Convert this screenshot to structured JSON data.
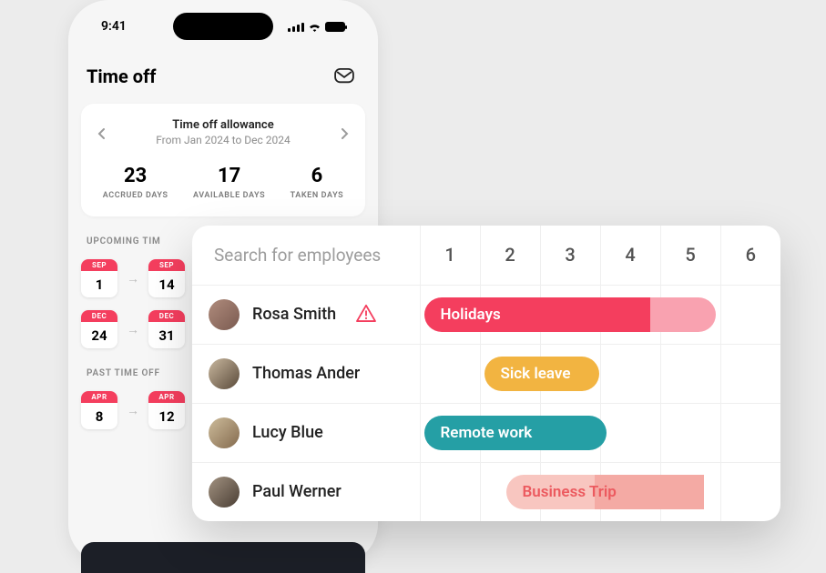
{
  "statusbar": {
    "time": "9:41"
  },
  "header": {
    "title": "Time off",
    "mail_icon": "mail-icon"
  },
  "allowance": {
    "title": "Time off allowance",
    "subtitle": "From Jan 2024 to Dec 2024",
    "stats": [
      {
        "value": "23",
        "label": "ACCRUED DAYS"
      },
      {
        "value": "17",
        "label": "AVAILABLE DAYS"
      },
      {
        "value": "6",
        "label": "TAKEN DAYS"
      }
    ]
  },
  "sections": {
    "upcoming": {
      "heading": "UPCOMING TIM",
      "rows": [
        {
          "from": {
            "month": "SEP",
            "day": "1"
          },
          "to": {
            "month": "SEP",
            "day": "14"
          }
        },
        {
          "from": {
            "month": "DEC",
            "day": "24"
          },
          "to": {
            "month": "DEC",
            "day": "31"
          }
        }
      ]
    },
    "past": {
      "heading": "PAST TIME OFF",
      "rows": [
        {
          "from": {
            "month": "APR",
            "day": "8"
          },
          "to": {
            "month": "APR",
            "day": "12"
          }
        }
      ]
    }
  },
  "panel": {
    "search_placeholder": "Search for employees",
    "columns": [
      "1",
      "2",
      "3",
      "4",
      "5",
      "6"
    ],
    "rows": [
      {
        "name": "Rosa Smith",
        "warning": true,
        "bar_class": "bar-holidays",
        "bar_start_col": 0,
        "bar_label": "Holidays"
      },
      {
        "name": "Thomas Ander",
        "warning": false,
        "bar_class": "bar-sick",
        "bar_start_col": 1,
        "bar_label": "Sick leave"
      },
      {
        "name": "Lucy Blue",
        "warning": false,
        "bar_class": "bar-remote",
        "bar_start_col": 0,
        "bar_label": "Remote work"
      },
      {
        "name": "Paul Werner",
        "warning": false,
        "bar_class": "bar-trip",
        "bar_start_col": 1,
        "bar_label": "Business Trip"
      }
    ]
  }
}
